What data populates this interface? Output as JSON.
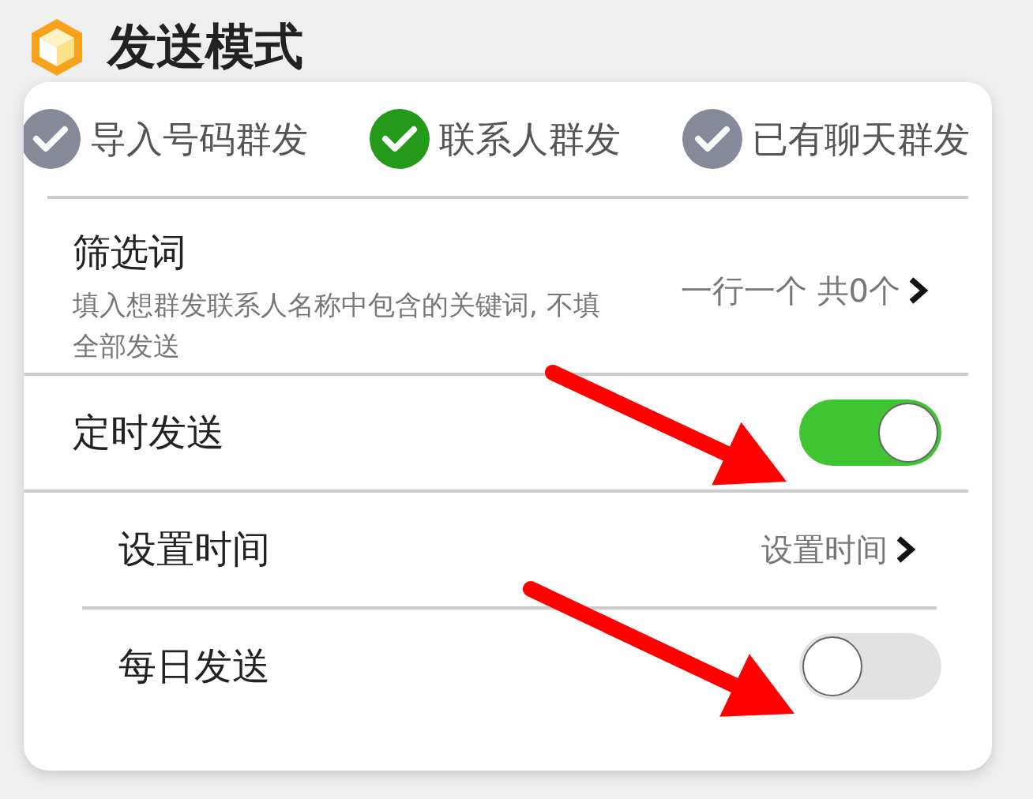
{
  "title": "发送模式",
  "modes": [
    {
      "label": "导入号码群发",
      "selected": false
    },
    {
      "label": "联系人群发",
      "selected": true
    },
    {
      "label": "已有聊天群发",
      "selected": false
    }
  ],
  "filter": {
    "title": "筛选词",
    "description": "填入想群发联系人名称中包含的关键词, 不填全部发送",
    "value": "一行一个 共0个"
  },
  "schedule": {
    "label": "定时发送",
    "on": true
  },
  "set_time": {
    "label": "设置时间",
    "value": "设置时间"
  },
  "daily": {
    "label": "每日发送",
    "on": false
  }
}
